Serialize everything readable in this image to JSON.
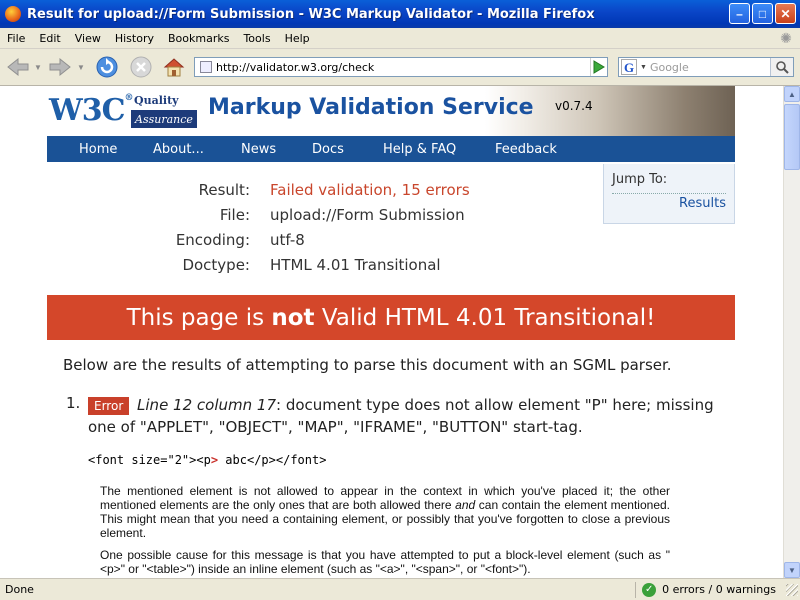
{
  "window": {
    "title": "Result for upload://Form Submission - W3C Markup Validator - Mozilla Firefox",
    "buttons": {
      "minimize": "–",
      "maximize": "□",
      "close": "✕"
    }
  },
  "menu": [
    "File",
    "Edit",
    "View",
    "History",
    "Bookmarks",
    "Tools",
    "Help"
  ],
  "toolbar": {
    "url": "http://validator.w3.org/check",
    "search_placeholder": "Google",
    "search_engine_letter": "G"
  },
  "header": {
    "w3c_logo": "W3C",
    "qa_top": "Quality",
    "qa_bottom": "Assurance",
    "title": "Markup Validation Service",
    "version": "v0.7.4"
  },
  "nav": [
    "Home",
    "About...",
    "News",
    "Docs",
    "Help & FAQ",
    "Feedback"
  ],
  "result": {
    "labels": {
      "result": "Result:",
      "file": "File:",
      "encoding": "Encoding:",
      "doctype": "Doctype:"
    },
    "result": "Failed validation, 15 errors",
    "file": "upload://Form Submission",
    "encoding": "utf-8",
    "doctype": "HTML 4.01 Transitional"
  },
  "jump": {
    "title": "Jump To:",
    "link": "Results"
  },
  "banner": {
    "pre": "This page is ",
    "strong": "not",
    "post": " Valid HTML 4.01 Transitional!"
  },
  "intro": "Below are the results of attempting to parse this document with an SGML parser.",
  "errors": [
    {
      "number": "1.",
      "badge": "Error",
      "location": "Line 12 column 17",
      "message": ": document type does not allow element \"P\" here; missing one of \"APPLET\", \"OBJECT\", \"MAP\", \"IFRAME\", \"BUTTON\" start-tag.",
      "code_before": "<font size=\"2\"><p",
      "code_mark": ">",
      "code_after": "abc</p></font>",
      "explain_1a": "The mentioned element is not allowed to appear in the context in which you've placed it; the other mentioned elements are the only ones that are both allowed there ",
      "explain_1em": "and",
      "explain_1b": " can contain the element mentioned. This might mean that you need a containing element, or possibly that you've forgotten to close a previous element.",
      "explain_2": "One possible cause for this message is that you have attempted to put a block-level element (such as \"<p>\" or \"<table>\") inside an inline element (such as \"<a>\", \"<span>\", or \"<font>\")."
    }
  ],
  "status": {
    "left": "Done",
    "right": "0 errors / 0 warnings"
  }
}
